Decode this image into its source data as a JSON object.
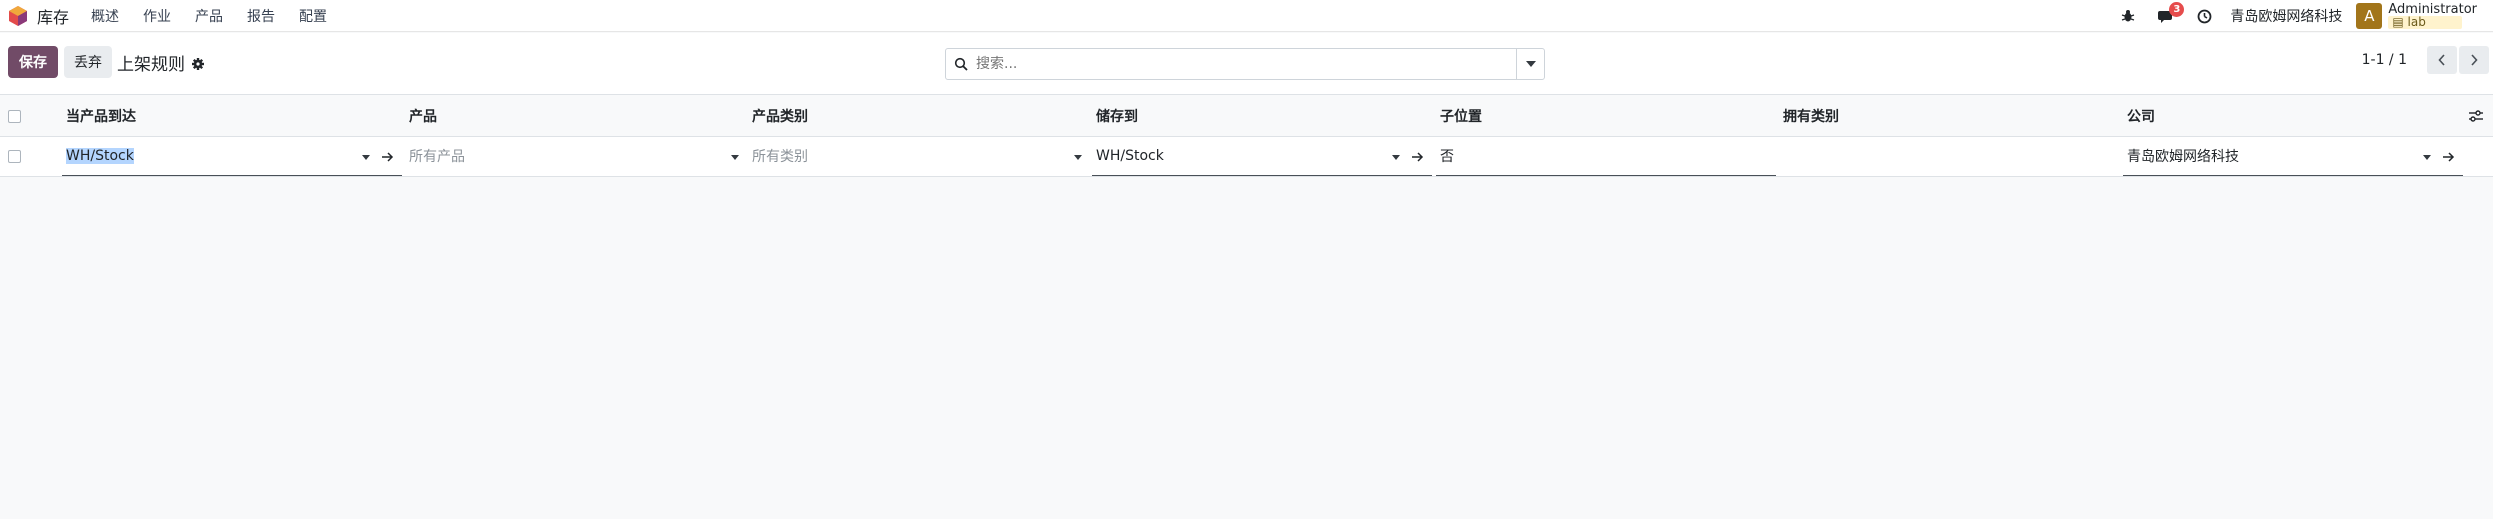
{
  "navbar": {
    "app_name": "库存",
    "menu": [
      "概述",
      "作业",
      "产品",
      "报告",
      "配置"
    ],
    "messages_badge": "3",
    "company": "青岛欧姆网络科技",
    "avatar_letter": "A",
    "user_name": "Administrator",
    "db_name": "lab"
  },
  "control_panel": {
    "save_label": "保存",
    "discard_label": "丢弃",
    "title": "上架规则",
    "search_placeholder": "搜索...",
    "pager": "1-1 / 1"
  },
  "table": {
    "headers": [
      "当产品到达",
      "产品",
      "产品类别",
      "储存到",
      "子位置",
      "拥有类别",
      "公司"
    ],
    "row": {
      "arrival": "WH/Stock",
      "product_placeholder": "所有产品",
      "category_placeholder": "所有类别",
      "store_to": "WH/Stock",
      "sublocation": "否",
      "package_type": "",
      "company": "青岛欧姆网络科技"
    }
  },
  "colors": {
    "primary": "#714b67",
    "badge": "#e64c4c",
    "avatar": "#a2751a",
    "selection": "#b4d5fe"
  },
  "icons": [
    "odoo-logo-icon",
    "bug-icon",
    "chat-icon",
    "clock-icon",
    "gear-icon",
    "search-icon",
    "caret-down-icon",
    "chevron-left-icon",
    "chevron-right-icon",
    "arrow-right-icon",
    "optional-columns-icon"
  ]
}
